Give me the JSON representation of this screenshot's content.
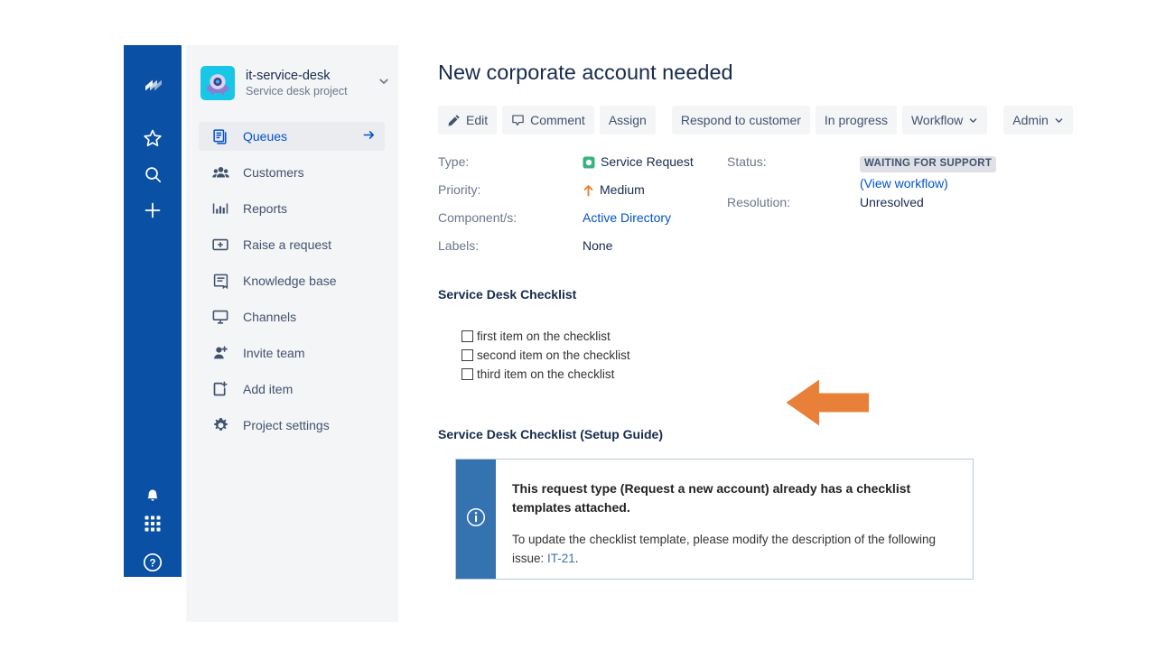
{
  "rail": {
    "icons": [
      {
        "name": "jira-logo-icon",
        "label": "Jira"
      },
      {
        "name": "star-icon",
        "label": "Starred"
      },
      {
        "name": "search-icon",
        "label": "Search"
      },
      {
        "name": "plus-icon",
        "label": "Create"
      },
      {
        "name": "notifications-bell-icon",
        "label": "Notifications"
      },
      {
        "name": "app-switcher-grid-icon",
        "label": "App switcher"
      },
      {
        "name": "help-question-icon",
        "label": "Help"
      }
    ]
  },
  "sidebar": {
    "project": {
      "name": "it-service-desk",
      "type": "Service desk project",
      "avatar_bg": "#18C7E8",
      "chevron": "chevron-down-icon"
    },
    "items": [
      {
        "label": "Queues",
        "icon": "queues-icon",
        "active": true,
        "arrow": true
      },
      {
        "label": "Customers",
        "icon": "customers-icon",
        "active": false,
        "arrow": false
      },
      {
        "label": "Reports",
        "icon": "reports-bar-chart-icon",
        "active": false,
        "arrow": false
      },
      {
        "label": "Raise a request",
        "icon": "raise-request-icon",
        "active": false,
        "arrow": false
      },
      {
        "label": "Knowledge base",
        "icon": "knowledge-base-icon",
        "active": false,
        "arrow": false
      },
      {
        "label": "Channels",
        "icon": "channels-monitor-icon",
        "active": false,
        "arrow": false
      },
      {
        "label": "Invite team",
        "icon": "invite-team-icon",
        "active": false,
        "arrow": false
      },
      {
        "label": "Add item",
        "icon": "add-item-icon",
        "active": false,
        "arrow": false
      },
      {
        "label": "Project settings",
        "icon": "gear-icon",
        "active": false,
        "arrow": false
      }
    ]
  },
  "issue": {
    "title": "New corporate account needed",
    "toolbar": [
      {
        "label": "Edit",
        "icon": "pencil-icon",
        "caret": false
      },
      {
        "label": "Comment",
        "icon": "comment-bubble-icon",
        "caret": false
      },
      {
        "label": "Assign",
        "icon": null,
        "caret": false
      },
      {
        "label": "Respond to customer",
        "icon": null,
        "caret": false
      },
      {
        "label": "In progress",
        "icon": null,
        "caret": false
      },
      {
        "label": "Workflow",
        "icon": null,
        "caret": true
      },
      {
        "label": "Admin",
        "icon": null,
        "caret": true
      }
    ],
    "fields_left": [
      {
        "label": "Type:",
        "value": "Service Request",
        "icon": "service-request-icon",
        "link": false
      },
      {
        "label": "Priority:",
        "value": "Medium",
        "icon": "priority-medium-icon",
        "link": false
      },
      {
        "label": "Component/s:",
        "value": "Active Directory",
        "icon": null,
        "link": true
      },
      {
        "label": "Labels:",
        "value": "None",
        "icon": null,
        "link": false
      }
    ],
    "fields_right": {
      "status_label": "Status:",
      "status_value": "WAITING FOR SUPPORT",
      "status_bg": "#DFE1E6",
      "view_workflow": "(View workflow)",
      "resolution_label": "Resolution:",
      "resolution_value": "Unresolved"
    }
  },
  "checklist": {
    "heading": "Service Desk Checklist",
    "items": [
      {
        "label": "first item on the checklist",
        "checked": false
      },
      {
        "label": "second item on the checklist",
        "checked": false
      },
      {
        "label": "third item on the checklist",
        "checked": false
      }
    ],
    "annotation": {
      "name": "orange-left-arrow-annotation",
      "color": "#E8803A"
    }
  },
  "setup_guide": {
    "heading": "Service Desk Checklist (Setup Guide)",
    "panel": {
      "accent_color": "#3572B0",
      "icon": "info-circle-icon",
      "strong_text": "This request type (Request a new account) already has a checklist templates attached.",
      "body_prefix": "To update the checklist template, please modify the description of the following issue: ",
      "body_link": "IT-21",
      "body_suffix": "."
    }
  }
}
